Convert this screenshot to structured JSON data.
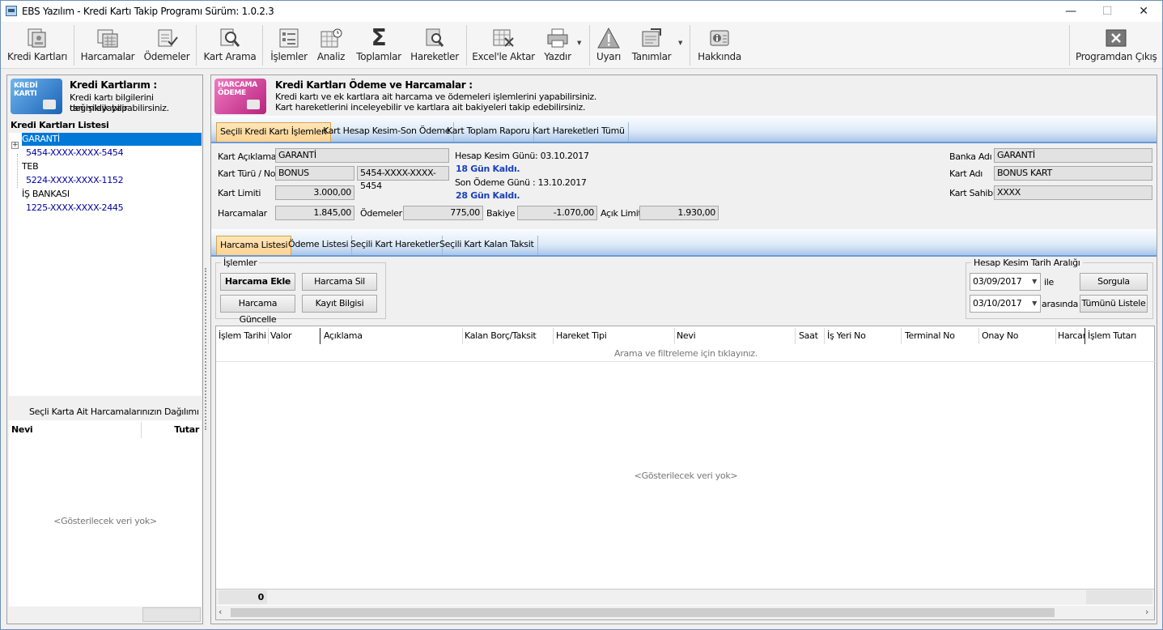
{
  "window": {
    "title": "EBS Yazılım - Kredi Kartı Takip Programı Sürüm: 1.0.2.3",
    "minimize": "—",
    "maximize": "☐",
    "close": "✕"
  },
  "toolbar": {
    "kredi_kartlari": "Kredi Kartları",
    "harcamalar": "Harcamalar",
    "odemeler": "Ödemeler",
    "kart_arama": "Kart Arama",
    "islemler": "İşlemler",
    "analiz": "Analiz",
    "toplamlar": "Toplamlar",
    "hareketler": "Hareketler",
    "excel_aktar": "Excel'le Aktar",
    "yazdir": "Yazdır",
    "uyari": "Uyarı",
    "tanimlar": "Tanımlar",
    "hakkinda": "Hakkında",
    "cikis": "Programdan Çıkış",
    "toplamlar_glyph": "Σ"
  },
  "left": {
    "header_title": "Kredi Kartlarım :",
    "header_desc1": "Kredi kartı bilgilerini tanımlayabilir",
    "header_desc2": "değişiklik yapabilirsiniz.",
    "card_img_text": "KREDİ KARTI",
    "list_title": "Kredi Kartları Listesi",
    "tree": [
      {
        "label": "GARANTİ"
      },
      {
        "label": "5454-XXXX-XXXX-5454"
      },
      {
        "label": "TEB"
      },
      {
        "label": "5224-XXXX-XXXX-1152"
      },
      {
        "label": "İŞ BANKASI"
      },
      {
        "label": "1225-XXXX-XXXX-2445"
      }
    ],
    "expand_glyph": "+",
    "dist_title": "Seçli Karta Ait Harcamalarınızın Dağılımı",
    "col_nevi": "Nevi",
    "col_tutar": "Tutar",
    "empty": "<Gösterilecek veri yok>"
  },
  "right": {
    "header_title": "Kredi Kartları Ödeme ve Harcamalar :",
    "header_desc1": "Kredi kartı ve ek kartlara ait harcama ve ödemeleri  işlemlerini yapabilirsiniz.",
    "header_desc2": "Kart hareketlerini inceleyebilir ve kartlara ait bakiyeleri takip edebilirsiniz.",
    "img_text1": "HARCAMA",
    "img_text2": "ÖDEME",
    "tabs": [
      "Seçili Kredi Kartı İşlemleri",
      "Kart Hesap Kesim-Son Ödeme",
      "Kart Toplam Raporu",
      "Kart Hareketleri Tümü"
    ],
    "form": {
      "kart_aciklama_lbl": "Kart Açıklama",
      "kart_aciklama": "GARANTİ",
      "kart_turu_lbl": "Kart Türü / No",
      "kart_turu": "BONUS",
      "kart_no": "5454-XXXX-XXXX-5454",
      "kart_limiti_lbl": "Kart Limiti",
      "kart_limiti": "3.000,00",
      "harcamalar_lbl": "Harcamalar",
      "harcamalar": "1.845,00",
      "odemeler_lbl": "Ödemeler",
      "odemeler": "775,00",
      "bakiye_lbl": "Bakiye",
      "bakiye": "-1.070,00",
      "acik_limit_lbl": "Açık Limit",
      "acik_limit": "1.930,00",
      "hesap_kesim": "Hesap Kesim Günü: 03.10.2017",
      "hesap_kalan": "18 Gün Kaldı.",
      "son_odeme": "Son Ödeme Günü  : 13.10.2017",
      "son_kalan": "28 Gün Kaldı.",
      "banka_adi_lbl": "Banka Adı",
      "banka_adi": "GARANTİ",
      "kart_adi_lbl": "Kart Adı",
      "kart_adi": "BONUS KART",
      "kart_sahibi_lbl": "Kart Sahibi",
      "kart_sahibi": "XXXX"
    },
    "subtabs": [
      "Harcama Listesi",
      "Ödeme Listesi",
      "Seçili Kart Hareketler",
      "Seçili Kart Kalan Taksit"
    ],
    "islemler_title": "İşlemler",
    "btn_ekle": "Harcama Ekle",
    "btn_sil": "Harcama Sil",
    "btn_guncelle": "Harcama Güncelle",
    "btn_kayit": "Kayıt Bilgisi",
    "tarih_title": "Hesap Kesim Tarih Aralığı",
    "date1": "03/09/2017",
    "date2": "03/10/2017",
    "ile": "ile",
    "arasinda": "arasında",
    "btn_sorgula": "Sorgula",
    "btn_tumu": "Tümünü Listele",
    "columns": [
      "İşlem Tarihi",
      "Valor",
      "Açıklama",
      "Kalan Borç/Taksit",
      "Hareket Tipi",
      "Nevi",
      "Saat",
      "İş Yeri No",
      "Terminal No",
      "Onay No",
      "Harcam",
      "İşlem Tutarı"
    ],
    "filter_hint": "Arama ve filtreleme için tıklayınız.",
    "empty": "<Gösterilecek veri yok>",
    "footer_count": "0"
  }
}
